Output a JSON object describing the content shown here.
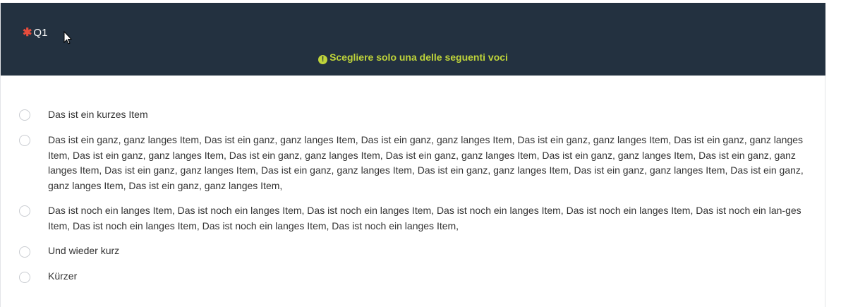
{
  "question": {
    "mandatory_marker": "✱",
    "code": "Q1",
    "hint_icon": "!",
    "hint": "Scegliere solo una delle seguenti voci"
  },
  "answers": [
    {
      "label": "Das ist ein kurzes Item"
    },
    {
      "label": "Das ist ein ganz, ganz langes Item, Das ist ein ganz, ganz langes Item, Das ist ein ganz, ganz langes Item, Das ist ein ganz, ganz langes Item, Das ist ein ganz, ganz langes Item, Das ist ein ganz, ganz langes Item, Das ist ein ganz, ganz langes Item, Das ist ein ganz, ganz langes Item, Das ist ein ganz, ganz langes Item, Das ist ein ganz, ganz langes Item, Das ist ein ganz, ganz langes Item, Das ist ein ganz, ganz langes Item, Das ist ein ganz, ganz langes Item, Das ist ein ganz, ganz langes Item, Das ist ein ganz, ganz langes Item, Das ist ein ganz, ganz langes Item,"
    },
    {
      "label": "Das ist noch ein langes Item, Das ist noch ein langes Item, Das ist noch ein langes Item, Das ist noch ein langes Item, Das ist noch ein langes Item, Das ist noch ein lan-ges Item, Das ist noch ein langes Item, Das ist noch ein langes Item, Das ist noch ein langes Item,"
    },
    {
      "label": "Und wieder kurz"
    },
    {
      "label": "Kürzer"
    }
  ],
  "colors": {
    "header_bg": "#233140",
    "mandatory": "#e74c3c",
    "hint": "#bfd43a",
    "text": "#333333"
  }
}
